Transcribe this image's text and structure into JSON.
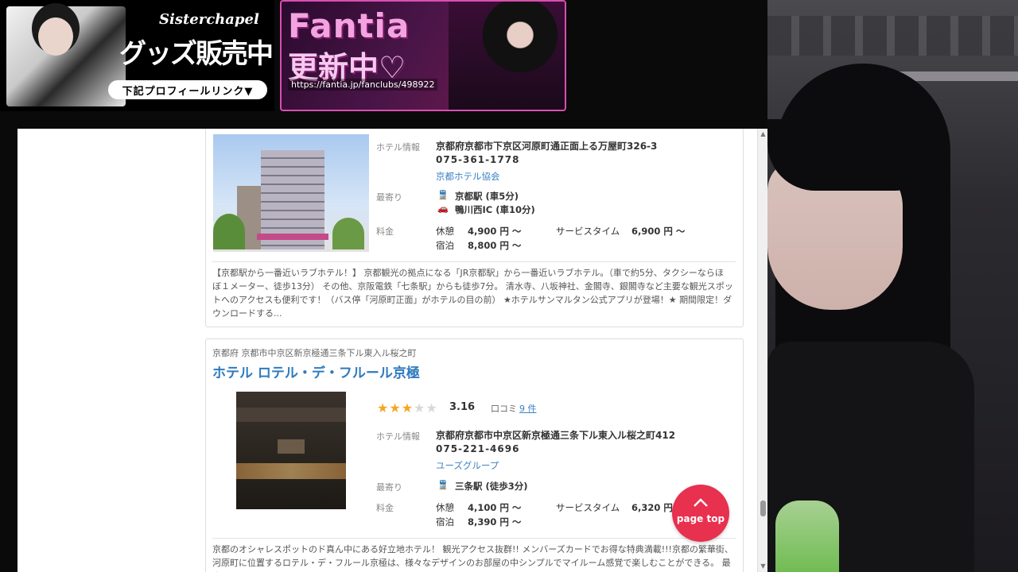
{
  "banners": {
    "goods": {
      "brand": "Sisterchapel",
      "title": "グッズ販売中",
      "pill": "下記プロフィールリンク▼"
    },
    "fantia": {
      "title": "Fantia",
      "subtitle": "更新中♡",
      "url": "https://fantia.jp/fanclubs/498922"
    }
  },
  "listing1": {
    "labels": {
      "hotel_info": "ホテル情報",
      "nearest": "最寄り",
      "price": "料金"
    },
    "address": "京都府京都市下京区河原町通正面上る万屋町326-3",
    "phone": "075-361-1778",
    "group_link": "京都ホテル協会",
    "nearest": [
      {
        "icon": "train-icon",
        "text": "京都駅 (車5分)"
      },
      {
        "icon": "car-icon",
        "text": "鴨川西IC (車10分)"
      }
    ],
    "prices": {
      "rest_label": "休憩",
      "rest_value": "4,900 円 〜",
      "stay_label": "宿泊",
      "stay_value": "8,800 円 〜",
      "service_label": "サービスタイム",
      "service_value": "6,900 円 〜"
    },
    "description": [
      "【京都駅から一番近いラブホテル！】 京都観光の拠点になる「JR京都駅」から一番近いラブホテル。（車で約5分、タクシーならほ",
      "ぼ１メーター、徒歩13分） その他、京阪電鉄「七条駅」からも徒歩7分。 清水寺、八坂神社、金閣寺、銀閣寺など主要な観光スポッ",
      "トへのアクセスも便利です！（バス停「河原町正面」がホテルの目の前） ★ホテルサンマルタン公式アプリが登場！★ 期間限定！ダ",
      "ウンロードする..."
    ]
  },
  "listing2": {
    "location": "京都府 京都市中京区新京極通三条下ル東入ル桜之町",
    "name": "ホテル ロテル・デ・フルール京極",
    "rating": 3.16,
    "rating_text": "3.16",
    "stars_filled": 3,
    "stars_total": 5,
    "review_label": "口コミ",
    "review_count": "9 件",
    "labels": {
      "hotel_info": "ホテル情報",
      "nearest": "最寄り",
      "price": "料金"
    },
    "address": "京都府京都市中京区新京極通三条下ル東入ル桜之町412",
    "phone": "075-221-4696",
    "group_link": "ユーズグループ",
    "nearest": [
      {
        "icon": "train-icon",
        "text": "三条駅 (徒歩3分)"
      }
    ],
    "prices": {
      "rest_label": "休憩",
      "rest_value": "4,100 円 〜",
      "stay_label": "宿泊",
      "stay_value": "8,390 円 〜",
      "service_label": "サービスタイム",
      "service_value": "6,320 円"
    },
    "description": [
      "京都のオシャレスポットのド真ん中にある好立地ホテル！ 観光アクセス抜群!! メンバーズカードでお得な特典満載!!!京都の繁華街、",
      "河原町に位置するロテル・デ・フルール京極は、様々なデザインのお部屋の中シンプルでマイルーム感覚で楽しむことができる。 最大"
    ]
  },
  "page_top": {
    "label": "page top"
  },
  "colors": {
    "accent_link": "#3b82c4",
    "page_top": "#e8304f",
    "star": "#f5a623"
  }
}
